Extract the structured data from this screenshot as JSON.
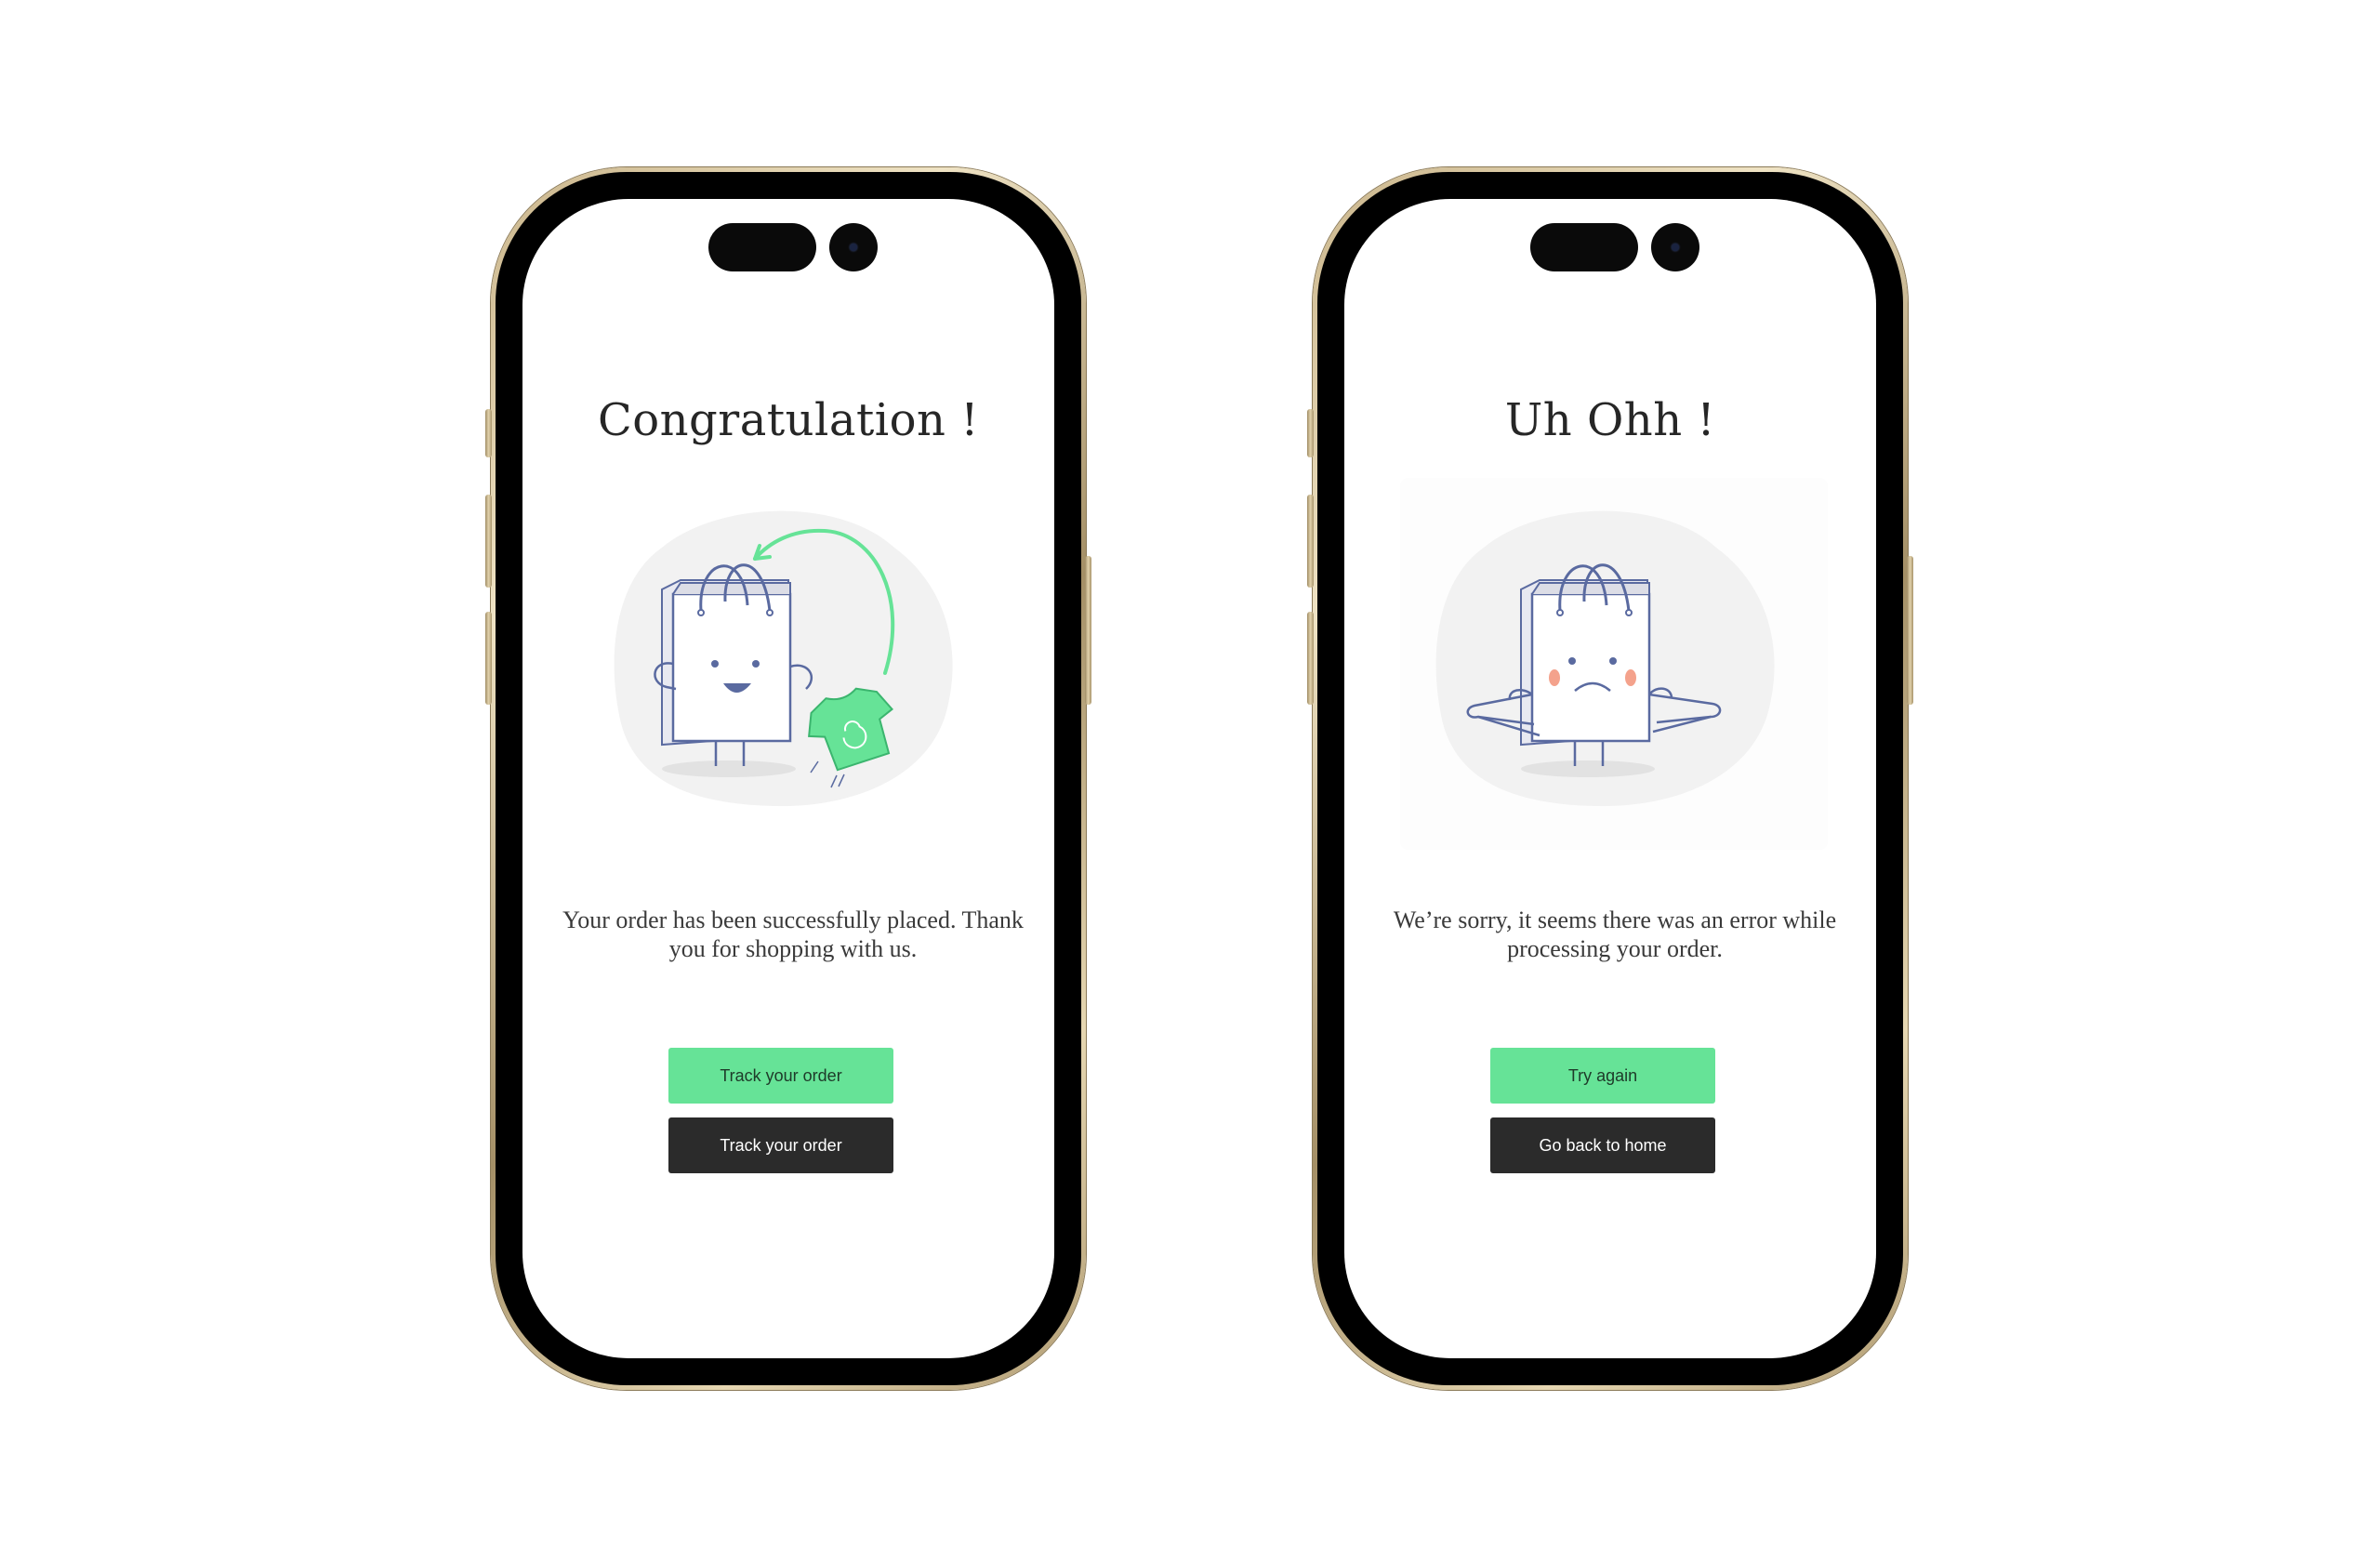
{
  "colors": {
    "accent_green": "#66e397",
    "dark_button": "#2b2b2b",
    "title_text": "#262626",
    "body_text": "#3a3a3a",
    "frame_gold": "#c9b48a",
    "illustration_line": "#5a6aa0",
    "blush": "#f4a28c"
  },
  "success_screen": {
    "title": "Congratulation !",
    "illustration": "happy-shopping-bag-with-shirt",
    "message": "Your order has been successfully placed. Thank you for shopping with us.",
    "primary_button": "Track your order",
    "secondary_button": "Track your order"
  },
  "error_screen": {
    "title": "Uh Ohh !",
    "illustration": "sad-shopping-bag-with-hangers",
    "message": "We’re sorry, it seems there was an error while processing your order.",
    "primary_button": "Try again",
    "secondary_button": "Go back to home"
  }
}
